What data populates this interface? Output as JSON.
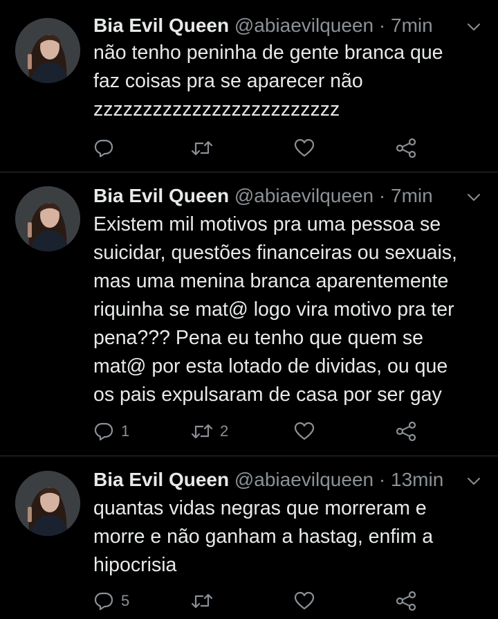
{
  "tweets": [
    {
      "author_name": "Bia Evil Queen",
      "handle": "@abiaevilqueen",
      "separator": "·",
      "time": "7min",
      "text": "não tenho peninha de gente branca que\nfaz coisas pra se aparecer não\nzzzzzzzzzzzzzzzzzzzzzzzzz",
      "reply_count": "",
      "retweet_count": "",
      "like_count": ""
    },
    {
      "author_name": "Bia Evil Queen",
      "handle": "@abiaevilqueen",
      "separator": "·",
      "time": "7min",
      "text": "Existem mil motivos pra uma pessoa se\nsuicidar, questões financeiras ou sexuais,\nmas uma menina branca aparentemente\nriquinha se mat@ logo vira motivo pra ter\npena??? Pena eu tenho que quem se\nmat@ por esta lotado de dividas, ou que\nos pais expulsaram de casa por ser gay",
      "reply_count": "1",
      "retweet_count": "2",
      "like_count": ""
    },
    {
      "author_name": "Bia Evil Queen",
      "handle": "@abiaevilqueen",
      "separator": "·",
      "time": "13min",
      "text": "quantas vidas negras que morreram e\nmorre e não ganham a hastag, enfim a\nhipocrisia",
      "reply_count": "5",
      "retweet_count": "",
      "like_count": ""
    }
  ],
  "icons": {
    "reply": "reply-icon",
    "retweet": "retweet-icon",
    "like": "heart-icon",
    "share": "share-icon",
    "menu": "chevron-down-icon"
  },
  "colors": {
    "background": "#000000",
    "text": "#e7e9ea",
    "secondary": "#8b9196",
    "divider": "#2f3336"
  }
}
